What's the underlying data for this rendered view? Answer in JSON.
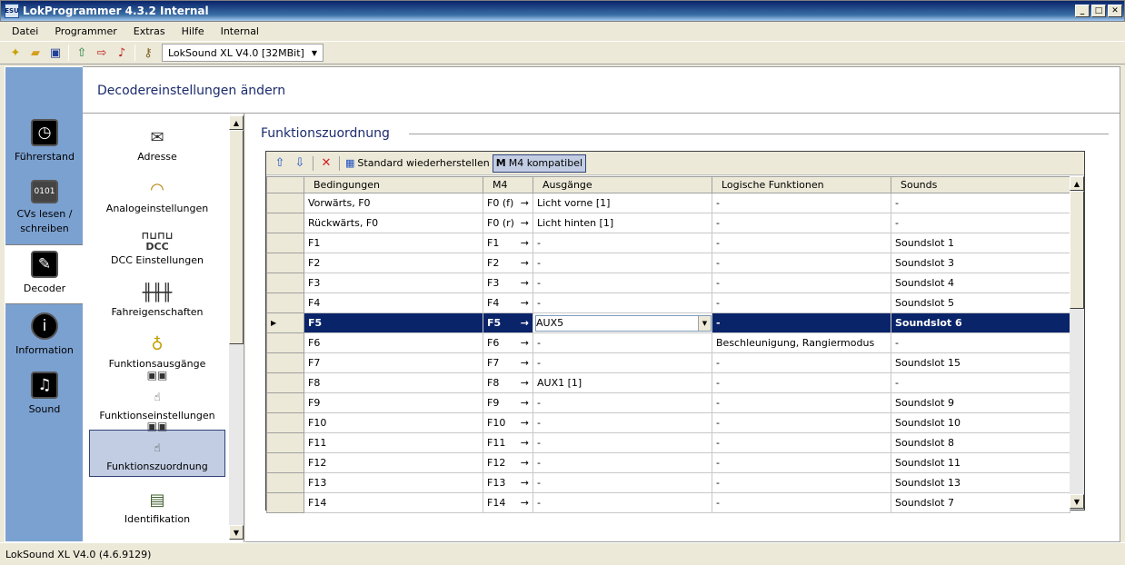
{
  "window": {
    "title": "LokProgrammer 4.3.2 Internal",
    "app_icon_text": "ESU"
  },
  "menu": [
    "Datei",
    "Programmer",
    "Extras",
    "Hilfe",
    "Internal"
  ],
  "toolbar": {
    "device": "LokSound XL V4.0 [32MBit]"
  },
  "left_nav": [
    {
      "label": "Führerstand",
      "icon": "cab-icon"
    },
    {
      "label": "CVs lesen / schreiben",
      "icon": "binary-icon"
    },
    {
      "label": "Decoder",
      "icon": "wrench-icon",
      "active": true
    },
    {
      "label": "Information",
      "icon": "info-icon"
    },
    {
      "label": "Sound",
      "icon": "music-note-icon"
    }
  ],
  "header": {
    "title": "Decodereinstellungen ändern"
  },
  "categories": [
    {
      "label": "Adresse",
      "icon": "envelope-icon"
    },
    {
      "label": "Analogeinstellungen",
      "icon": "analog-meter-icon"
    },
    {
      "label": "DCC Einstellungen",
      "icon": "dcc-icon",
      "icon_text": "DCC"
    },
    {
      "label": "Fahreigenschaften",
      "icon": "sliders-icon"
    },
    {
      "label": "Funktionsausgänge",
      "icon": "bulb-icon"
    },
    {
      "label": "Funktionseinstellungen",
      "icon": "hand-switch-icon"
    },
    {
      "label": "Funktionszuordnung",
      "icon": "hand-switch-icon",
      "selected": true
    },
    {
      "label": "Identifikation",
      "icon": "id-card-icon"
    }
  ],
  "section": {
    "title": "Funktionszuordnung"
  },
  "grid_toolbar": {
    "restore": "Standard wiederherstellen",
    "m4": "M4 kompatibel"
  },
  "columns": [
    "Bedingungen",
    "M4",
    "Ausgänge",
    "Logische Funktionen",
    "Sounds"
  ],
  "rows": [
    {
      "cond": "Vorwärts, F0",
      "m4": "F0 (f)",
      "out": "Licht vorne [1]",
      "logic": "-",
      "sound": "-"
    },
    {
      "cond": "Rückwärts, F0",
      "m4": "F0 (r)",
      "out": "Licht hinten [1]",
      "logic": "-",
      "sound": "-"
    },
    {
      "cond": "F1",
      "m4": "F1",
      "out": "-",
      "logic": "-",
      "sound": "Soundslot 1"
    },
    {
      "cond": "F2",
      "m4": "F2",
      "out": "-",
      "logic": "-",
      "sound": "Soundslot 3"
    },
    {
      "cond": "F3",
      "m4": "F3",
      "out": "-",
      "logic": "-",
      "sound": "Soundslot 4"
    },
    {
      "cond": "F4",
      "m4": "F4",
      "out": "-",
      "logic": "-",
      "sound": "Soundslot 5"
    },
    {
      "cond": "F5",
      "m4": "F5",
      "out": "AUX5",
      "logic": "-",
      "sound": "Soundslot 6",
      "selected": true
    },
    {
      "cond": "F6",
      "m4": "F6",
      "out": "-",
      "logic": "Beschleunigung, Rangiermodus",
      "sound": "-"
    },
    {
      "cond": "F7",
      "m4": "F7",
      "out": "-",
      "logic": "-",
      "sound": "Soundslot 15"
    },
    {
      "cond": "F8",
      "m4": "F8",
      "out": "AUX1 [1]",
      "logic": "-",
      "sound": "-"
    },
    {
      "cond": "F9",
      "m4": "F9",
      "out": "-",
      "logic": "-",
      "sound": "Soundslot 9"
    },
    {
      "cond": "F10",
      "m4": "F10",
      "out": "-",
      "logic": "-",
      "sound": "Soundslot 10"
    },
    {
      "cond": "F11",
      "m4": "F11",
      "out": "-",
      "logic": "-",
      "sound": "Soundslot 8"
    },
    {
      "cond": "F12",
      "m4": "F12",
      "out": "-",
      "logic": "-",
      "sound": "Soundslot 11"
    },
    {
      "cond": "F13",
      "m4": "F13",
      "out": "-",
      "logic": "-",
      "sound": "Soundslot 13"
    },
    {
      "cond": "F14",
      "m4": "F14",
      "out": "-",
      "logic": "-",
      "sound": "Soundslot 7"
    }
  ],
  "arrow_glyph": "→",
  "status": {
    "text": "LokSound XL V4.0 (4.6.9129)"
  }
}
